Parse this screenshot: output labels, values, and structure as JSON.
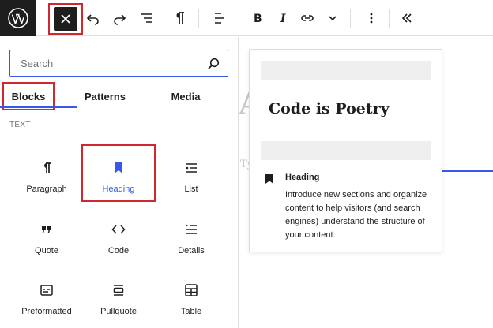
{
  "toolbar": {
    "logo_icon": "wordpress-icon",
    "close_icon": "close-icon",
    "buttons": [
      {
        "name": "undo",
        "icon": "undo-icon"
      },
      {
        "name": "redo",
        "icon": "redo-icon"
      },
      {
        "name": "document-overview",
        "icon": "list-view-icon"
      },
      {
        "name": "paragraph",
        "icon": "pilcrow-icon"
      },
      {
        "name": "align",
        "icon": "align-left-icon"
      },
      {
        "name": "bold",
        "icon": "bold-icon",
        "label": "B"
      },
      {
        "name": "italic",
        "icon": "italic-icon",
        "label": "I"
      },
      {
        "name": "link",
        "icon": "link-icon"
      },
      {
        "name": "more-rich-text",
        "icon": "chevron-down-icon"
      },
      {
        "name": "options",
        "icon": "more-vertical-icon"
      },
      {
        "name": "collapse",
        "icon": "double-chevron-left-icon"
      }
    ]
  },
  "inserter": {
    "search": {
      "placeholder": "Search",
      "value": ""
    },
    "tabs": [
      {
        "label": "Blocks",
        "selected": true
      },
      {
        "label": "Patterns",
        "selected": false
      },
      {
        "label": "Media",
        "selected": false
      }
    ],
    "category": "TEXT",
    "blocks": [
      {
        "label": "Paragraph",
        "icon": "paragraph-icon"
      },
      {
        "label": "Heading",
        "icon": "heading-bookmark-icon",
        "active": true
      },
      {
        "label": "List",
        "icon": "list-icon"
      },
      {
        "label": "Quote",
        "icon": "quote-icon"
      },
      {
        "label": "Code",
        "icon": "code-icon"
      },
      {
        "label": "Details",
        "icon": "details-icon"
      },
      {
        "label": "Preformatted",
        "icon": "preformatted-icon"
      },
      {
        "label": "Pullquote",
        "icon": "pullquote-icon"
      },
      {
        "label": "Table",
        "icon": "table-icon"
      }
    ]
  },
  "canvas": {
    "title_fragment": "A",
    "sub_fragment": "Ty"
  },
  "preview": {
    "heading_text": "Code is Poetry",
    "block_title": "Heading",
    "block_icon": "heading-bookmark-icon",
    "description": "Introduce new sections and organize content to help visitors (and search engines) understand the structure of your content."
  },
  "colors": {
    "accent": "#3858e9",
    "highlight_border": "#d0282f",
    "dark": "#1e1e1e"
  }
}
